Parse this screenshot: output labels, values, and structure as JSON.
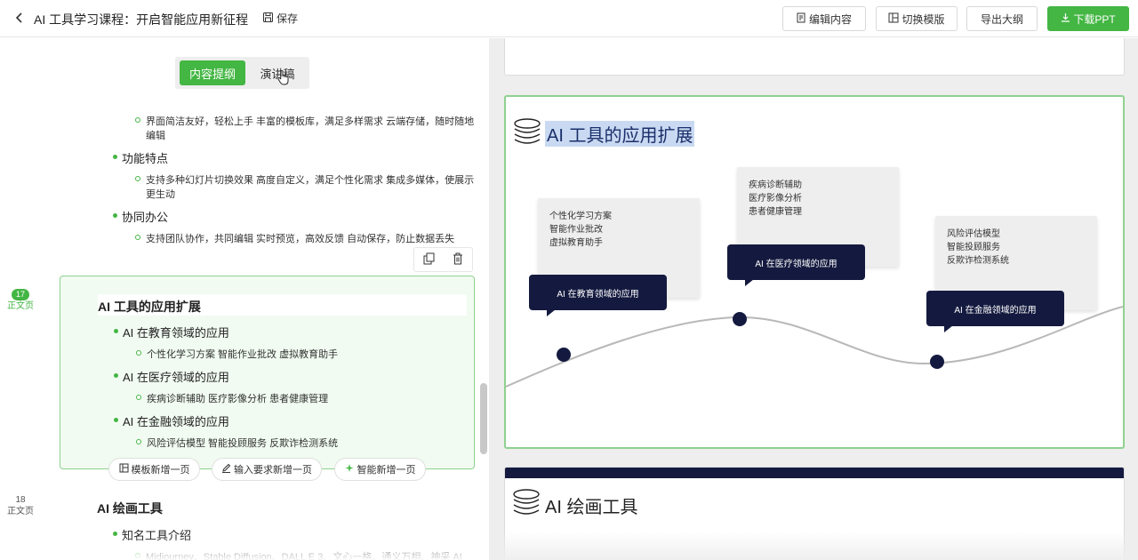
{
  "header": {
    "title": "AI 工具学习课程：开启智能应用新征程",
    "save_label": "保存",
    "buttons": {
      "edit": "编辑内容",
      "switch_template": "切换模版",
      "export_outline": "导出大纲",
      "download": "下载PPT"
    }
  },
  "left": {
    "tabs": {
      "outline": "内容提纲",
      "script": "演讲稿"
    },
    "outline": [
      {
        "level": 3,
        "text": "界面简洁友好，轻松上手 丰富的模板库，满足多样需求 云端存储，随时随地"
      },
      {
        "level": 3,
        "text": "编辑",
        "cont": true
      },
      {
        "level": 2,
        "text": "功能特点"
      },
      {
        "level": 3,
        "text": "支持多种幻灯片切换效果 高度自定义，满足个性化需求 集成多媒体，使展示"
      },
      {
        "level": 3,
        "text": "更生动",
        "cont": true
      },
      {
        "level": 2,
        "text": "协同办公"
      },
      {
        "level": 3,
        "text": "支持团队协作，共同编辑 实时预览，高效反馈 自动保存，防止数据丢失"
      }
    ],
    "page17": {
      "number": "17",
      "label": "正文页"
    },
    "selected_section": {
      "title": "AI 工具的应用扩展",
      "items": [
        {
          "level": 2,
          "text": "AI 在教育领域的应用"
        },
        {
          "level": 3,
          "text": "个性化学习方案 智能作业批改 虚拟教育助手"
        },
        {
          "level": 2,
          "text": "AI 在医疗领域的应用"
        },
        {
          "level": 3,
          "text": "疾病诊断辅助 医疗影像分析 患者健康管理"
        },
        {
          "level": 2,
          "text": "AI 在金融领域的应用"
        },
        {
          "level": 3,
          "text": "风险评估模型 智能投顾服务 反欺诈检测系统"
        }
      ]
    },
    "add_buttons": {
      "template": "模板新增一页",
      "input": "输入要求新增一页",
      "smart": "智能新增一页"
    },
    "page18": {
      "number": "18",
      "label": "正文页"
    },
    "next_section": {
      "title": "AI 绘画工具",
      "items": [
        {
          "level": 2,
          "text": "知名工具介绍"
        },
        {
          "level": 3,
          "text": "Midjourney、Stable Diffusion、DALL E 3、文心一格、通义万相、神采 AI"
        }
      ]
    }
  },
  "slide": {
    "title": "AI 工具的应用扩展",
    "cards": [
      {
        "lines": [
          "个性化学习方案",
          "智能作业批改",
          "虚拟教育助手"
        ],
        "bubble": "AI 在教育领域的应用"
      },
      {
        "lines": [
          "疾病诊断辅助",
          "医疗影像分析",
          "患者健康管理"
        ],
        "bubble": "AI 在医疗领域的应用"
      },
      {
        "lines": [
          "风险评估模型",
          "智能投顾服务",
          "反欺诈检测系统"
        ],
        "bubble": "AI 在金融领域的应用"
      }
    ]
  },
  "next_slide": {
    "title": "AI 绘画工具"
  },
  "colors": {
    "accent_green": "#43b643",
    "selection_border": "#8fd18f",
    "navy": "#141a3f",
    "title_highlight": "#c9d9f2"
  }
}
